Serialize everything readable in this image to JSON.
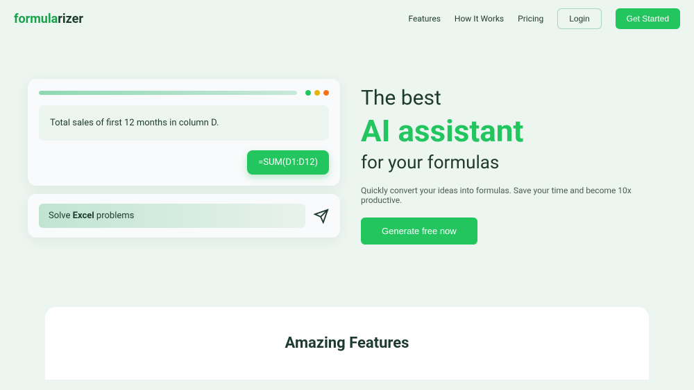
{
  "header": {
    "logo_part1": "formula",
    "logo_part2": "rizer",
    "nav": {
      "features": "Features",
      "how_it_works": "How It Works",
      "pricing": "Pricing",
      "login": "Login",
      "get_started": "Get Started"
    }
  },
  "hero": {
    "query_text": "Total sales of first 12 months in column D.",
    "formula_result": "=SUM(D1:D12)",
    "search_prefix": "Solve ",
    "search_bold": "Excel",
    "search_suffix": " problems",
    "headline_1": "The best",
    "headline_2": "AI assistant",
    "headline_3": "for your formulas",
    "subtext": "Quickly convert your ideas into formulas. Save your time and become 10x productive.",
    "cta_button": "Generate free now"
  },
  "features": {
    "title": "Amazing Features"
  }
}
